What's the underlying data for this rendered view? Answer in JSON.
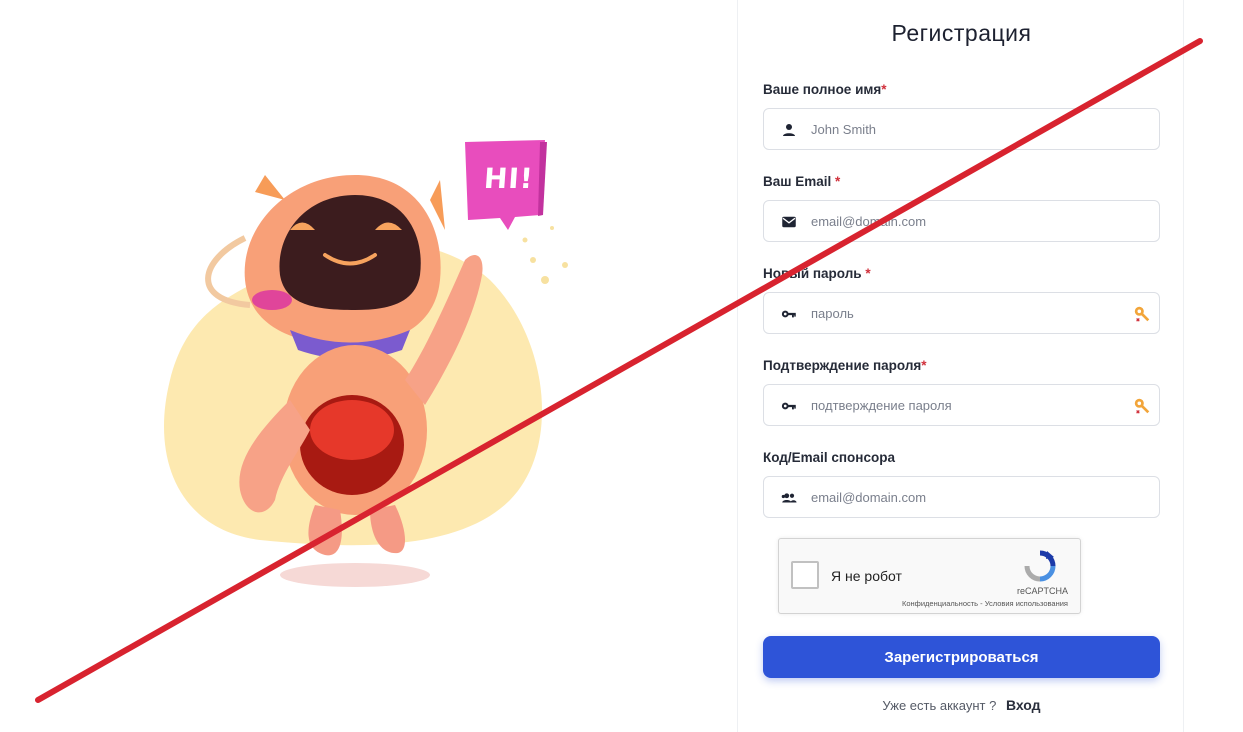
{
  "form": {
    "title": "Регистрация",
    "full_name": {
      "label": "Ваше полное имя",
      "required_mark": "*",
      "placeholder": "John Smith",
      "icon": "person-icon"
    },
    "email": {
      "label": "Ваш Email",
      "required_mark": "*",
      "placeholder": "email@domain.com",
      "icon": "envelope-icon"
    },
    "password": {
      "label": "Новый пароль",
      "required_mark": "*",
      "placeholder": "пароль",
      "icon": "key-icon"
    },
    "password_confirm": {
      "label": "Подтверждение пароля",
      "required_mark": "*",
      "placeholder": "подтверждение пароля",
      "icon": "key-icon"
    },
    "sponsor": {
      "label": "Код/Email спонсора",
      "placeholder": "email@domain.com",
      "icon": "group-icon"
    },
    "captcha": {
      "label": "Я не робот",
      "brand": "reCAPTCHA",
      "terms": "Конфиденциальность - Условия использования"
    },
    "submit_label": "Зарегистрироваться",
    "login_prompt": "Уже есть аккаунт ?",
    "login_link": "Вход"
  },
  "illustration": {
    "speech_bubble": "HI!"
  },
  "colors": {
    "accent": "#2e54d8",
    "required": "#d0303b",
    "overlay_cross": "#d8232f"
  }
}
